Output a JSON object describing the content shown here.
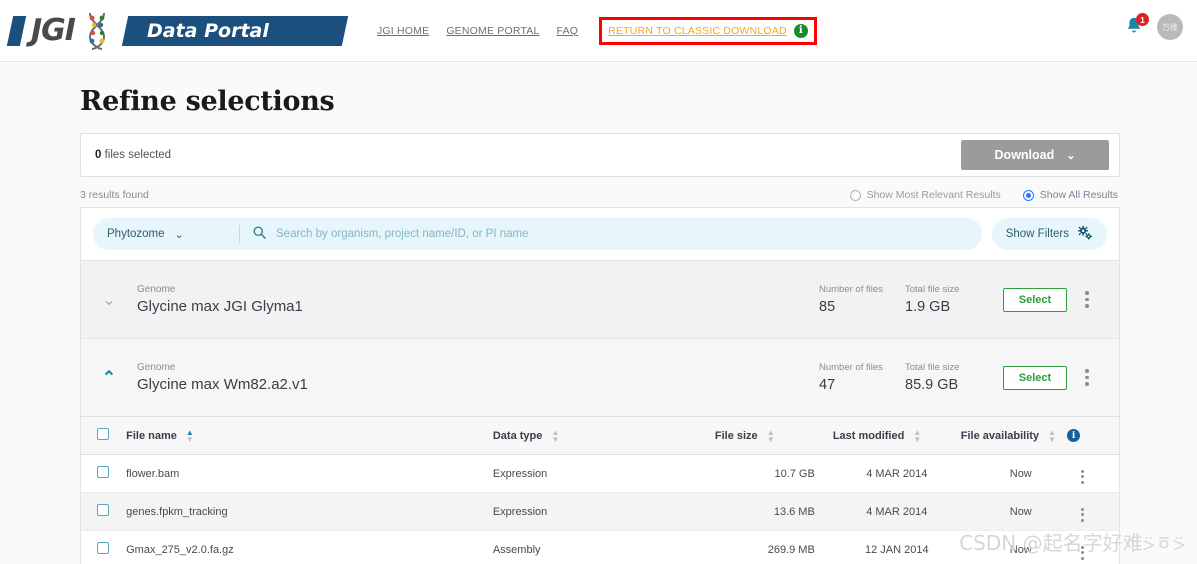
{
  "header": {
    "logo_text": "JGI",
    "banner_title": "Data Portal",
    "dna_icon": "dna-icon",
    "nav": [
      {
        "label": "JGI HOME",
        "name": "nav-jgi-home"
      },
      {
        "label": "GENOME PORTAL",
        "name": "nav-genome-portal"
      },
      {
        "label": "FAQ",
        "name": "nav-faq"
      }
    ],
    "highlighted_nav": {
      "label": "RETURN TO CLASSIC DOWNLOAD",
      "info_glyph": "i",
      "highlight_color": "#ff0000",
      "link_color": "#f5a623"
    },
    "notifications": {
      "icon": "bell-icon",
      "count": "1"
    },
    "avatar": {
      "icon": "avatar",
      "text": "万维"
    }
  },
  "page": {
    "title": "Refine selections"
  },
  "selection_bar": {
    "count": "0",
    "count_label": " files selected",
    "download_label": "Download",
    "download_chevron": "⌄"
  },
  "results": {
    "found_text": "3 results found",
    "options": [
      {
        "label": "Show Most Relevant Results",
        "selected": false
      },
      {
        "label": "Show All Results",
        "selected": true
      }
    ]
  },
  "search": {
    "dropdown_value": "Phytozome",
    "dropdown_chevron": "⌄",
    "search_icon": "search-icon",
    "placeholder": "Search by organism, project name/ID, or PI name",
    "filters_label": "Show Filters",
    "filters_icon": "gears-icon"
  },
  "genomes": [
    {
      "kind": "Genome",
      "name": "Glycine max JGI Glyma1",
      "expanded": false,
      "chevron": "⌄",
      "files_label": "Number of files",
      "files_value": "85",
      "size_label": "Total file size",
      "size_value": "1.9 GB",
      "select_label": "Select"
    },
    {
      "kind": "Genome",
      "name": "Glycine max Wm82.a2.v1",
      "expanded": true,
      "chevron": "⌃",
      "files_label": "Number of files",
      "files_value": "47",
      "size_label": "Total file size",
      "size_value": "85.9 GB",
      "select_label": "Select"
    }
  ],
  "file_table": {
    "columns": [
      {
        "label": "File name",
        "sort": "asc"
      },
      {
        "label": "Data type",
        "sort": "none"
      },
      {
        "label": "File size",
        "sort": "none"
      },
      {
        "label": "Last modified",
        "sort": "none"
      },
      {
        "label": "File availability",
        "sort": "none",
        "info": "i"
      }
    ],
    "rows": [
      {
        "name": "flower.bam",
        "type": "Expression",
        "size": "10.7 GB",
        "modified": "4 MAR 2014",
        "availability": "Now"
      },
      {
        "name": "genes.fpkm_tracking",
        "type": "Expression",
        "size": "13.6 MB",
        "modified": "4 MAR 2014",
        "availability": "Now"
      },
      {
        "name": "Gmax_275_v2.0.fa.gz",
        "type": "Assembly",
        "size": "269.9 MB",
        "modified": "12 JAN 2014",
        "availability": "Now"
      }
    ]
  },
  "watermark": "CSDN @起名字好难⍩ㆆ⍩"
}
